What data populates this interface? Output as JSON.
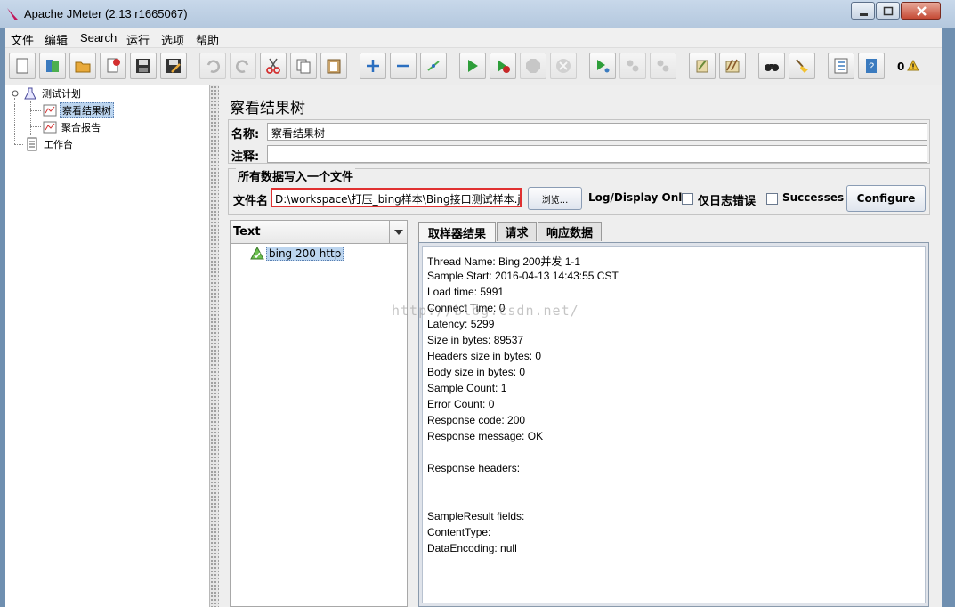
{
  "window": {
    "title": "Apache JMeter (2.13 r1665067)"
  },
  "menu": [
    "文件",
    "编辑",
    "Search",
    "运行",
    "选项",
    "帮助"
  ],
  "toolbar": {
    "buttons": [
      {
        "name": "new-icon",
        "enabled": true
      },
      {
        "name": "templates-icon",
        "enabled": true
      },
      {
        "name": "open-icon",
        "enabled": true
      },
      {
        "name": "close-icon",
        "enabled": true
      },
      {
        "name": "save-icon",
        "enabled": true
      },
      {
        "name": "save-as-icon",
        "enabled": true
      },
      {
        "name": "undo-icon",
        "enabled": false
      },
      {
        "name": "redo-icon",
        "enabled": false
      },
      {
        "name": "cut-icon",
        "enabled": true
      },
      {
        "name": "copy-icon",
        "enabled": true
      },
      {
        "name": "paste-icon",
        "enabled": true
      },
      {
        "name": "expand-icon",
        "enabled": true
      },
      {
        "name": "collapse-icon",
        "enabled": true
      },
      {
        "name": "toggle-icon",
        "enabled": true
      },
      {
        "name": "start-icon",
        "enabled": true
      },
      {
        "name": "start-no-pause-icon",
        "enabled": true
      },
      {
        "name": "stop-icon",
        "enabled": false
      },
      {
        "name": "shutdown-icon",
        "enabled": false
      },
      {
        "name": "remote-start-icon",
        "enabled": true
      },
      {
        "name": "remote-stop-icon",
        "enabled": false
      },
      {
        "name": "remote-shutdown-icon",
        "enabled": false
      },
      {
        "name": "clear-icon",
        "enabled": true
      },
      {
        "name": "clear-all-icon",
        "enabled": true
      },
      {
        "name": "search-icon",
        "enabled": true
      },
      {
        "name": "reset-search-icon",
        "enabled": true
      },
      {
        "name": "function-helper-icon",
        "enabled": true
      },
      {
        "name": "help-icon",
        "enabled": true
      }
    ],
    "error_count": "0"
  },
  "tree": {
    "root": "测试计划",
    "children": [
      "察看结果树",
      "聚合报告"
    ],
    "workbench": "工作台"
  },
  "panel": {
    "title": "察看结果树",
    "name_label": "名称:",
    "name_value": "察看结果树",
    "comment_label": "注释:",
    "comment_value": "",
    "file_group_title": "所有数据写入一个文件",
    "file_label": "文件名",
    "file_value": "D:\\workspace\\打压_bing样本\\Bing接口测试样本.jtl",
    "browse_button": "浏览...",
    "log_display_label": "Log/Display Only:",
    "errors_only_label": "仅日志错误",
    "successes_label": "Successes",
    "configure_button": "Configure"
  },
  "results": {
    "renderer": "Text",
    "samples": [
      "bing 200 http"
    ],
    "tabs": [
      "取样器结果",
      "请求",
      "响应数据"
    ],
    "lines": [
      "Thread Name: Bing 200并发 1-1",
      "Sample Start: 2016-04-13 14:43:55 CST",
      "Load time: 5991",
      "Connect Time: 0",
      "Latency: 5299",
      "Size in bytes: 89537",
      "Headers size in bytes: 0",
      "Body size in bytes: 0",
      "Sample Count: 1",
      "Error Count: 0",
      "Response code: 200",
      "Response message: OK",
      "",
      "Response headers:",
      "",
      "",
      "SampleResult fields:",
      "ContentType: ",
      "DataEncoding: null"
    ]
  },
  "watermark": "http://blog.csdn.net/"
}
